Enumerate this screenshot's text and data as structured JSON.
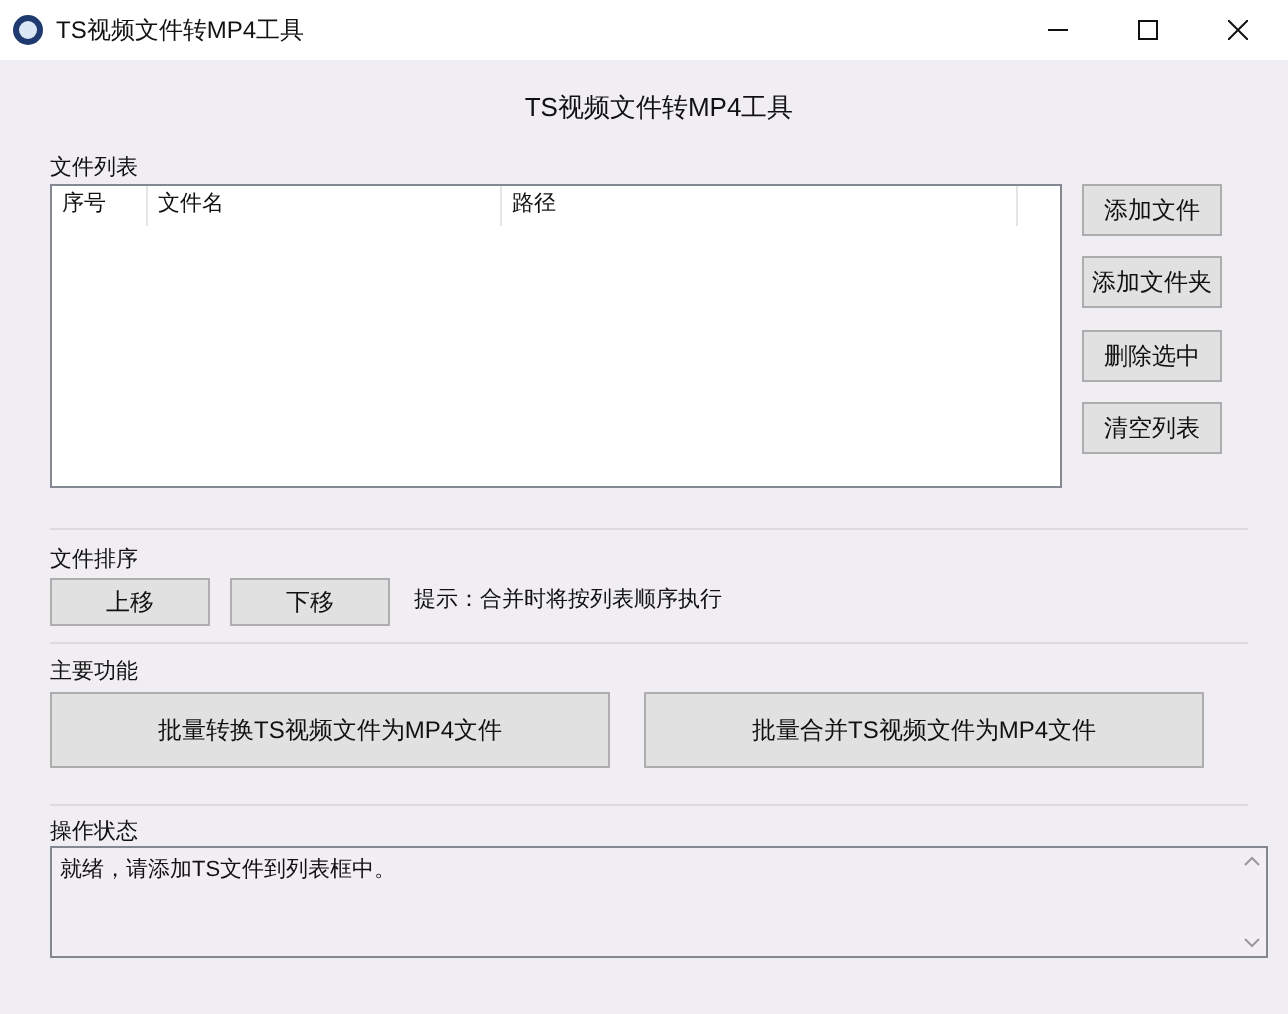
{
  "window": {
    "title": "TS视频文件转MP4工具",
    "controls": [
      {
        "kind": "minimize"
      },
      {
        "kind": "maximize"
      },
      {
        "kind": "close"
      }
    ]
  },
  "heading": "TS视频文件转MP4工具",
  "file_list": {
    "label": "文件列表",
    "columns": [
      "序号",
      "文件名",
      "路径"
    ],
    "buttons": [
      "添加文件",
      "添加文件夹",
      "删除选中",
      "清空列表"
    ]
  },
  "sort": {
    "label": "文件排序",
    "buttons": [
      "上移",
      "下移"
    ],
    "hint": "提示：合并时将按列表顺序执行"
  },
  "main": {
    "label": "主要功能",
    "buttons": [
      "批量转换TS视频文件为MP4文件",
      "批量合并TS视频文件为MP4文件"
    ]
  },
  "status": {
    "label": "操作状态",
    "text": "就绪，请添加TS文件到列表框中。"
  }
}
